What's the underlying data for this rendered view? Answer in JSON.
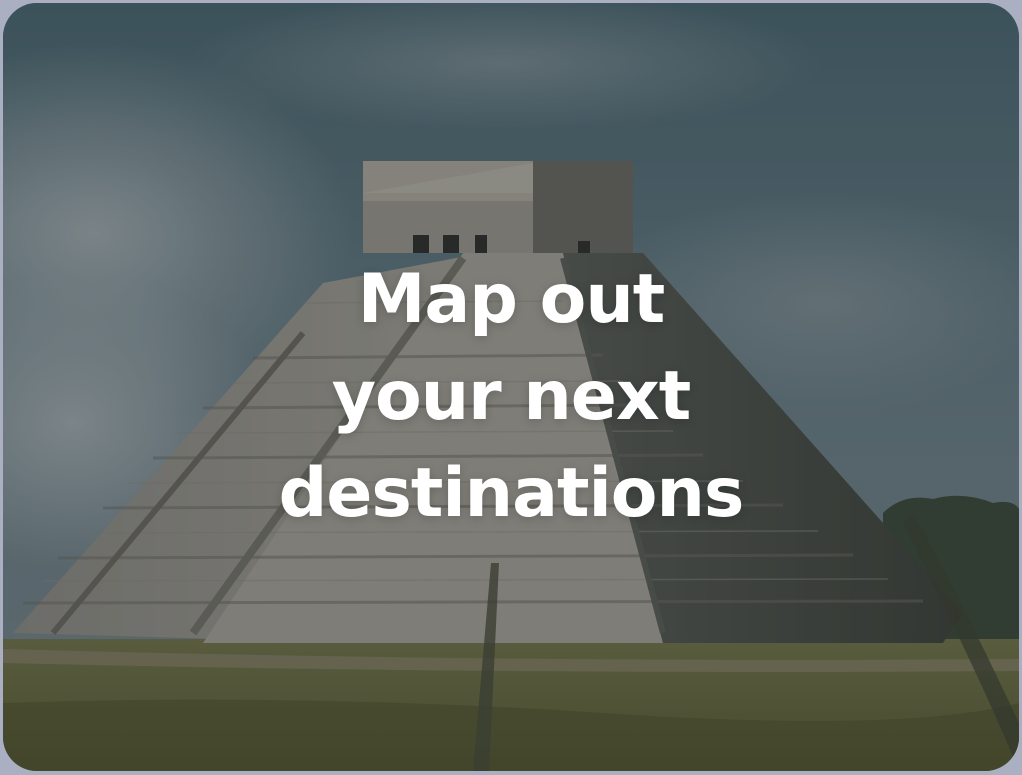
{
  "hero": {
    "title_lines": [
      "Map out",
      "your next",
      "destinations"
    ]
  },
  "background": {
    "image": "stepped-pyramid-photo",
    "colors": {
      "sky_top": "#4d6870",
      "sky_mid": "#6f8288",
      "stone": "#9b968a",
      "grass": "#6a6a3e",
      "border": "#aab0c2"
    }
  }
}
